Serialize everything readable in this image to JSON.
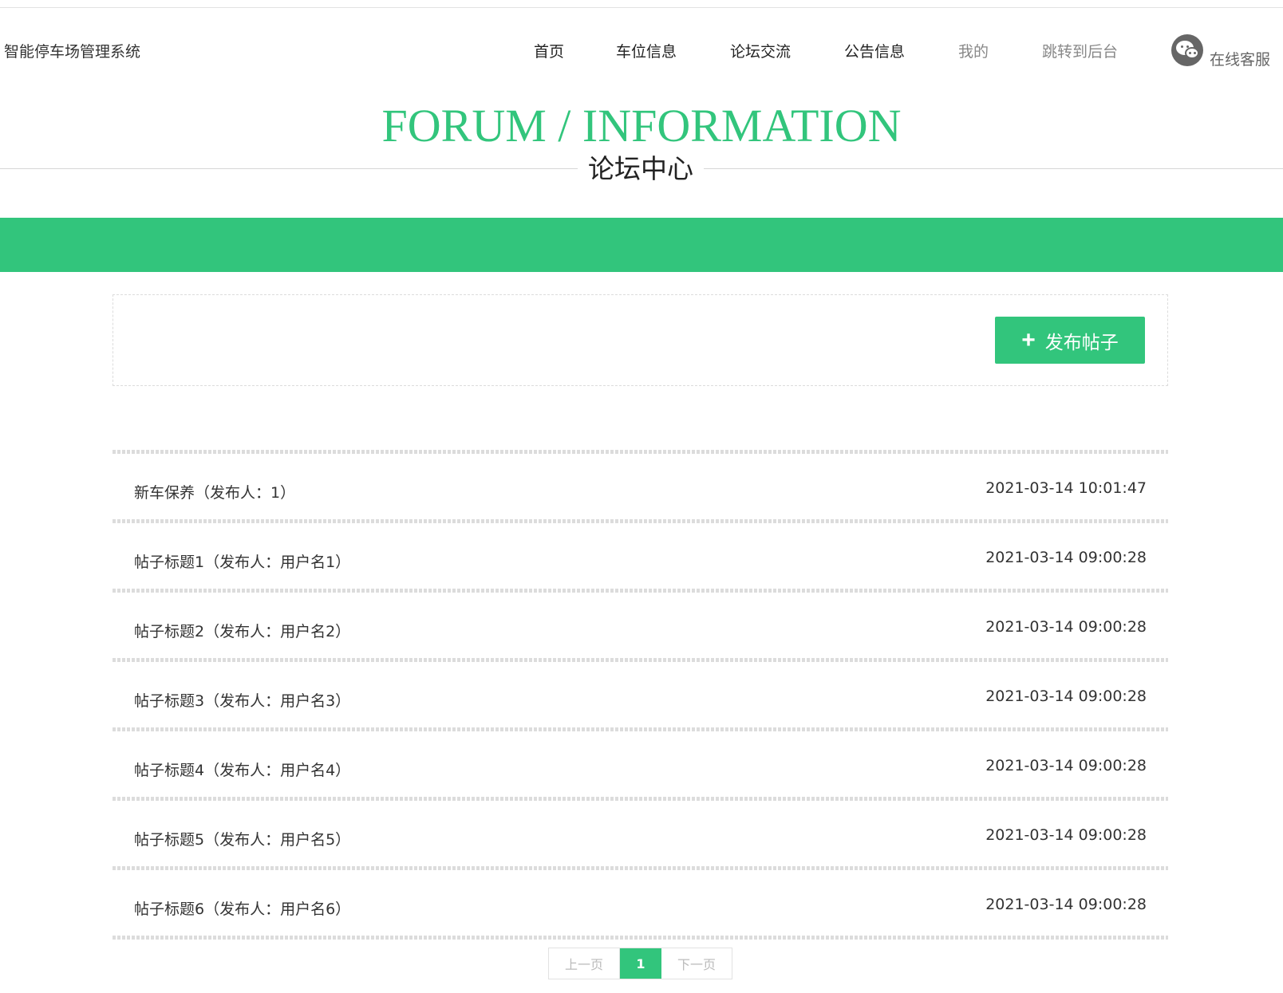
{
  "header": {
    "site_title": "智能停车场管理系统",
    "nav": [
      {
        "label": "首页"
      },
      {
        "label": "车位信息"
      },
      {
        "label": "论坛交流"
      },
      {
        "label": "公告信息"
      },
      {
        "label": "我的"
      },
      {
        "label": "跳转到后台"
      }
    ],
    "service_label": "在线客服",
    "service_icon": "wechat-icon"
  },
  "hero": {
    "title_en": "FORUM / INFORMATION",
    "title_cn": "论坛中心"
  },
  "actions": {
    "publish_label": "发布帖子",
    "publish_icon": "plus-icon"
  },
  "posts": [
    {
      "title": "新车保养（发布人：1）",
      "time": "2021-03-14 10:01:47"
    },
    {
      "title": "帖子标题1（发布人：用户名1）",
      "time": "2021-03-14 09:00:28"
    },
    {
      "title": "帖子标题2（发布人：用户名2）",
      "time": "2021-03-14 09:00:28"
    },
    {
      "title": "帖子标题3（发布人：用户名3）",
      "time": "2021-03-14 09:00:28"
    },
    {
      "title": "帖子标题4（发布人：用户名4）",
      "time": "2021-03-14 09:00:28"
    },
    {
      "title": "帖子标题5（发布人：用户名5）",
      "time": "2021-03-14 09:00:28"
    },
    {
      "title": "帖子标题6（发布人：用户名6）",
      "time": "2021-03-14 09:00:28"
    }
  ],
  "pagination": {
    "prev_label": "上一页",
    "current_page": "1",
    "next_label": "下一页"
  },
  "colors": {
    "accent": "#32c57c",
    "text": "#333333",
    "muted": "#888888"
  }
}
